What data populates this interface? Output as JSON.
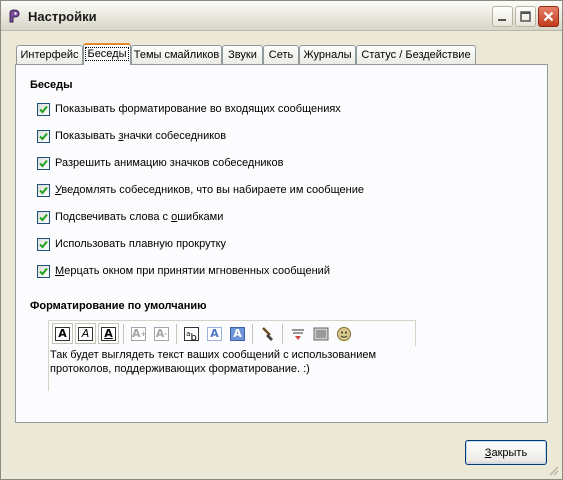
{
  "window": {
    "title": "Настройки",
    "controls": [
      "minimize",
      "maximize",
      "close"
    ]
  },
  "tabs": [
    {
      "label": "Интерфейс",
      "active": false
    },
    {
      "label": "Беседы",
      "active": true
    },
    {
      "label": "Темы смайликов",
      "active": false
    },
    {
      "label": "Звуки",
      "active": false
    },
    {
      "label": "Сеть",
      "active": false
    },
    {
      "label": "Журналы",
      "active": false
    },
    {
      "label": "Статус / Бездействие",
      "active": false
    }
  ],
  "conversations": {
    "title": "Беседы",
    "options": [
      {
        "label": "Показывать форматирование во входящих сообщениях",
        "checked": true
      },
      {
        "pre": "Показывать ",
        "accel": "з",
        "post": "начки собеседников",
        "checked": true
      },
      {
        "label": "Разрешить анимацию значков собеседников",
        "checked": true
      },
      {
        "pre": "",
        "accel": "У",
        "post": "ведомлять собеседников, что вы набираете им сообщение",
        "checked": true
      },
      {
        "pre": "Подсвечивать слова с ",
        "accel": "о",
        "post": "шибками",
        "checked": true
      },
      {
        "label": "Использовать плавную прокрутку",
        "checked": true
      },
      {
        "pre": "",
        "accel": "М",
        "post": "ерцать окном при принятии мгновенных сообщений",
        "checked": true
      }
    ]
  },
  "formatting": {
    "title": "Форматирование по умолчанию",
    "toolbar_icons": [
      "bold-icon",
      "italic-icon",
      "underline-icon",
      "font-bigger-icon",
      "font-smaller-icon",
      "font-face-icon",
      "foreground-color-icon",
      "background-color-icon",
      "clear-formatting-icon",
      "insert-link-icon",
      "insert-image-icon",
      "insert-smiley-icon"
    ],
    "preview_line1": "Так будет выглядеть текст ваших сообщений с использованием",
    "preview_line2": "протоколов, поддерживающих форматирование. :)"
  },
  "footer": {
    "close_pre": "",
    "close_accel": "З",
    "close_post": "акрыть"
  },
  "colors": {
    "accent_tab": "#e68b2c",
    "checkmark": "#21a121",
    "close_button": "#c23b1d"
  }
}
